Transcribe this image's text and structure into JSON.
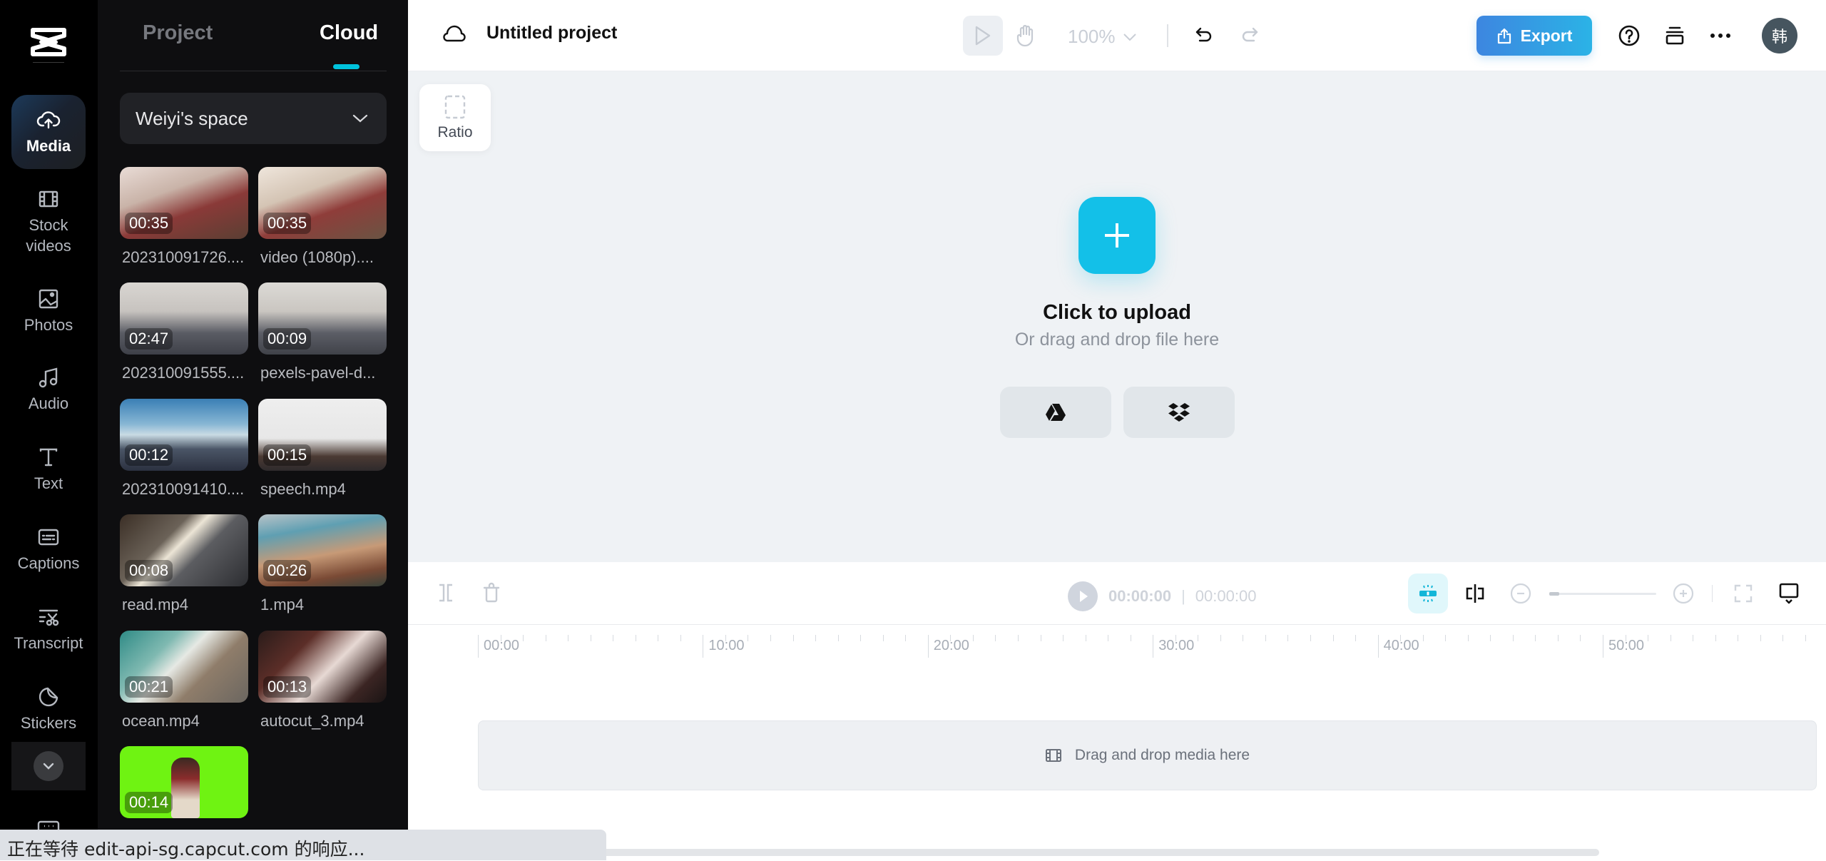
{
  "sidebar": {
    "logo": "capcut-logo",
    "items": [
      {
        "label": "Media",
        "icon": "cloud-upload-icon",
        "active": true
      },
      {
        "label": "Stock videos",
        "icon": "film-icon"
      },
      {
        "label": "Photos",
        "icon": "image-icon"
      },
      {
        "label": "Audio",
        "icon": "music-note-icon"
      },
      {
        "label": "Text",
        "icon": "text-icon"
      },
      {
        "label": "Captions",
        "icon": "captions-icon"
      },
      {
        "label": "Transcript",
        "icon": "transcript-icon"
      },
      {
        "label": "Stickers",
        "icon": "sticker-icon"
      }
    ],
    "more_icon": "chevron-down-icon"
  },
  "panel": {
    "tabs": [
      {
        "label": "Project",
        "active": false
      },
      {
        "label": "Cloud",
        "active": true
      }
    ],
    "space_selector": "Weiyi's space",
    "media": [
      {
        "name": "202310091726....",
        "duration": "00:35"
      },
      {
        "name": "video (1080p)....",
        "duration": "00:35"
      },
      {
        "name": "202310091555....",
        "duration": "02:47"
      },
      {
        "name": "pexels-pavel-d...",
        "duration": "00:09"
      },
      {
        "name": "202310091410....",
        "duration": "00:12"
      },
      {
        "name": "speech.mp4",
        "duration": "00:15"
      },
      {
        "name": "read.mp4",
        "duration": "00:08"
      },
      {
        "name": "1.mp4",
        "duration": "00:26"
      },
      {
        "name": "ocean.mp4",
        "duration": "00:21"
      },
      {
        "name": "autocut_3.mp4",
        "duration": "00:13"
      },
      {
        "name": "",
        "duration": "00:14"
      }
    ]
  },
  "topbar": {
    "project_title": "Untitled project",
    "zoom": "100%",
    "export_label": "Export",
    "avatar": "韩"
  },
  "canvas": {
    "ratio_label": "Ratio",
    "upload_title": "Click to upload",
    "upload_subtitle": "Or drag and drop file here",
    "sources": [
      "google-drive",
      "dropbox"
    ]
  },
  "timeline": {
    "current_time": "00:00:00",
    "total_time": "00:00:00",
    "zoom_level": 0.05,
    "ruler_labels": [
      "00:00",
      "10:00",
      "20:00",
      "30:00",
      "40:00",
      "50:00"
    ],
    "drop_hint": "Drag and drop media here"
  },
  "status_bar": "正在等待 edit-api-sg.capcut.com 的响应...",
  "colors": {
    "accent": "#00c3dd",
    "upload": "#13c0e8",
    "export_from": "#3d86e0",
    "export_to": "#2bb3e6"
  }
}
